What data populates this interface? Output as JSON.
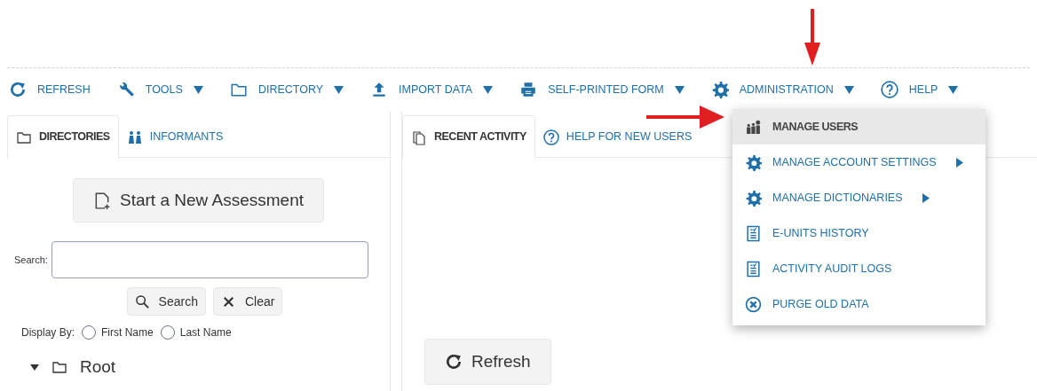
{
  "toolbar": [
    {
      "label": "REFRESH",
      "kind": "refresh",
      "dropdown": false
    },
    {
      "label": "TOOLS",
      "kind": "wrench",
      "dropdown": true
    },
    {
      "label": "DIRECTORY",
      "kind": "folder",
      "dropdown": true
    },
    {
      "label": "IMPORT DATA",
      "kind": "upload",
      "dropdown": true
    },
    {
      "label": "SELF-PRINTED FORM",
      "kind": "printer",
      "dropdown": true
    },
    {
      "label": "ADMINISTRATION",
      "kind": "gear",
      "dropdown": true
    },
    {
      "label": "HELP",
      "kind": "help",
      "dropdown": true
    }
  ],
  "left_tabs": [
    {
      "label": "DIRECTORIES",
      "kind": "folder",
      "selected": true
    },
    {
      "label": "INFORMANTS",
      "kind": "people",
      "selected": false
    }
  ],
  "new_assessment_button": "Start a New Assessment",
  "search": {
    "label": "Search:"
  },
  "search_buttons": [
    {
      "label": "Search",
      "kind": "search"
    },
    {
      "label": "Clear",
      "kind": "close"
    }
  ],
  "display_by": {
    "label": "Display By:",
    "options": [
      {
        "label": "First Name",
        "selected": false
      },
      {
        "label": "Last Name",
        "selected": false
      }
    ]
  },
  "tree": [
    {
      "label": "Root",
      "expanded": true
    }
  ],
  "right_tabs": [
    {
      "label": "RECENT ACTIVITY",
      "kind": "pages",
      "selected": true
    },
    {
      "label": "HELP FOR NEW USERS",
      "kind": "help",
      "selected": false
    }
  ],
  "refresh_button": "Refresh",
  "admin_menu": [
    {
      "label": "MANAGE USERS",
      "kind": "users",
      "submenu": false,
      "selected": true
    },
    {
      "label": "MANAGE ACCOUNT SETTINGS",
      "kind": "gear",
      "submenu": true,
      "selected": false
    },
    {
      "label": "MANAGE DICTIONARIES",
      "kind": "gear",
      "submenu": true,
      "selected": false
    },
    {
      "label": "E-UNITS HISTORY",
      "kind": "doc",
      "submenu": false,
      "selected": false
    },
    {
      "label": "ACTIVITY AUDIT LOGS",
      "kind": "doc",
      "submenu": false,
      "selected": false
    },
    {
      "label": "PURGE OLD DATA",
      "kind": "xcircle",
      "submenu": false,
      "selected": false
    }
  ]
}
